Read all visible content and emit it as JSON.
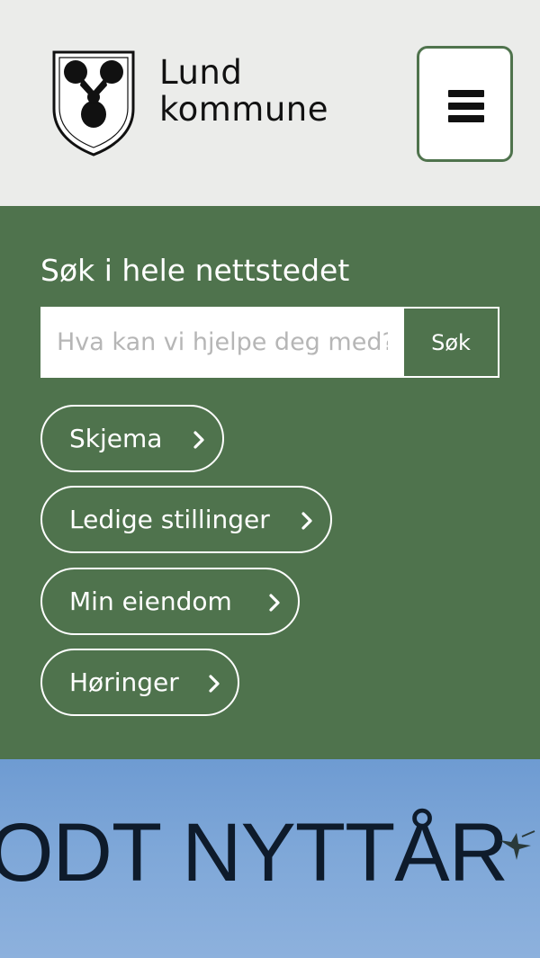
{
  "header": {
    "logo": {
      "line1": "Lund",
      "line2": "kommune",
      "icon": "coat-of-arms-shield-icon"
    },
    "menu_button": {
      "icon": "hamburger-menu-icon"
    }
  },
  "search": {
    "heading": "Søk i hele nettstedet",
    "placeholder": "Hva kan vi hjelpe deg med?",
    "button_label": "Søk"
  },
  "quick_links": [
    {
      "label": "Skjema",
      "icon": "chevron-right-icon"
    },
    {
      "label": "Ledige stillinger",
      "icon": "chevron-right-icon"
    },
    {
      "label": "Min eiendom",
      "icon": "chevron-right-icon"
    },
    {
      "label": "Høringer",
      "icon": "chevron-right-icon"
    }
  ],
  "banner": {
    "text": "ODT NYTTÅR"
  },
  "colors": {
    "brand_green": "#4f734d",
    "header_bg": "#ebecea",
    "banner_sky": "#7ea7d8"
  }
}
